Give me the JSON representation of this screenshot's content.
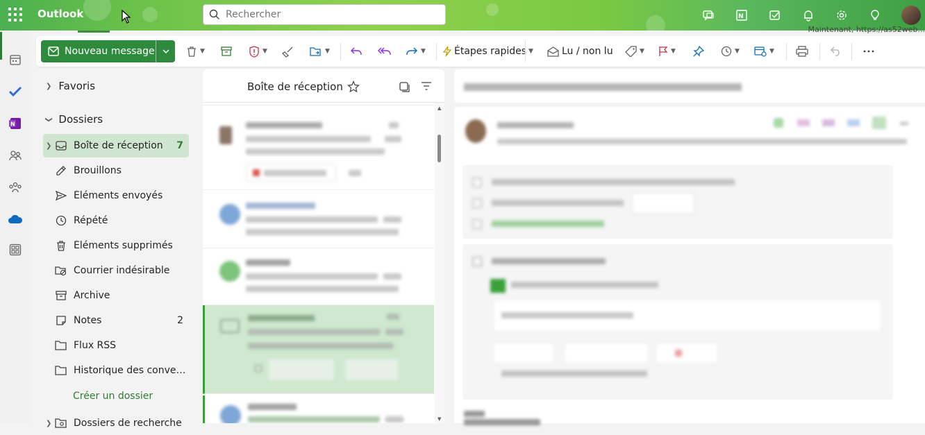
{
  "app": {
    "name": "Outlook"
  },
  "search": {
    "placeholder": "Rechercher"
  },
  "header": {
    "url_fragment": "Maintenant, https://as52web..."
  },
  "toolbar": {
    "new_message": "Nouveau message",
    "quick_steps": "Étapes rapides",
    "read_unread": "Lu / non lu"
  },
  "folders": {
    "favorites": "Favoris",
    "folders_group": "Dossiers",
    "items": [
      {
        "label": "Boîte de réception",
        "count": "7"
      },
      {
        "label": "Brouillons",
        "count": ""
      },
      {
        "label": "Éléments envoyés",
        "count": ""
      },
      {
        "label": "Répété",
        "count": ""
      },
      {
        "label": "Éléments supprimés",
        "count": ""
      },
      {
        "label": "Courrier indésirable",
        "count": ""
      },
      {
        "label": "Archive",
        "count": ""
      },
      {
        "label": "Notes",
        "count": "2"
      },
      {
        "label": "Flux RSS",
        "count": ""
      },
      {
        "label": "Historique des convers...",
        "count": ""
      }
    ],
    "create_folder": "Créer un dossier",
    "search_folders": "Dossiers de recherche"
  },
  "message_list": {
    "title": "Boîte de réception"
  },
  "colors": {
    "accent": "#2e8b3e",
    "selected": "#cfe5cf",
    "link": "#2e7d32"
  }
}
